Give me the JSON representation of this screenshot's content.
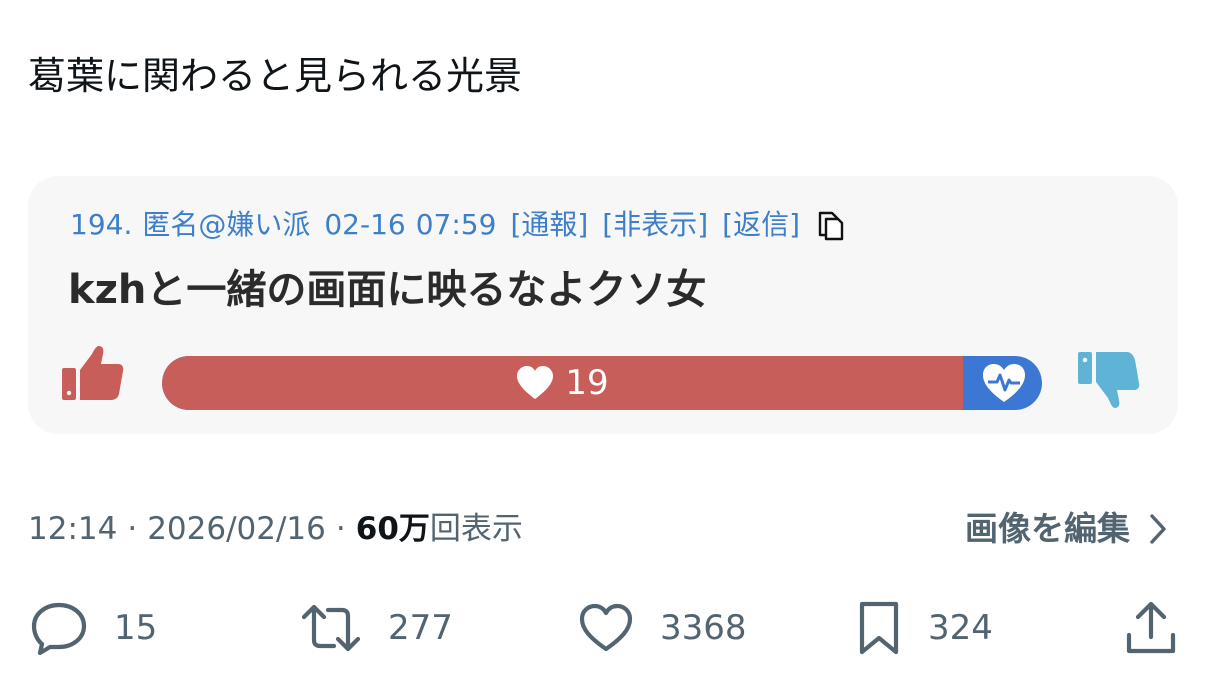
{
  "tweet": {
    "text": "葛葉に関わると見られる光景"
  },
  "card": {
    "post_number": "194.",
    "author": "匿名@嫌い派",
    "date": "02-16",
    "time": "07:59",
    "report_link": "[通報]",
    "hide_link": "[非表示]",
    "reply_link": "[返信]",
    "comment": "kzhと一緒の画面に映るなよクソ女",
    "vote_count": "19",
    "vote_fill_fraction": 0.91,
    "colors": {
      "like_bar": "#c85e5a",
      "dislike_bar": "#3c78d3",
      "thumb_down": "#5fb4d6"
    },
    "icons": [
      "copy-icon",
      "thumbs-up-icon",
      "heart-icon",
      "heart-pulse-icon",
      "thumbs-down-icon"
    ]
  },
  "info": {
    "time": "12:14",
    "separator1": "·",
    "date": "2026/02/16",
    "separator2": "·",
    "views_number": "60万",
    "views_label": "回表示",
    "edit_image": "画像を編集"
  },
  "actions": {
    "replies": "15",
    "reposts": "277",
    "likes": "3368",
    "bookmarks": "324"
  }
}
